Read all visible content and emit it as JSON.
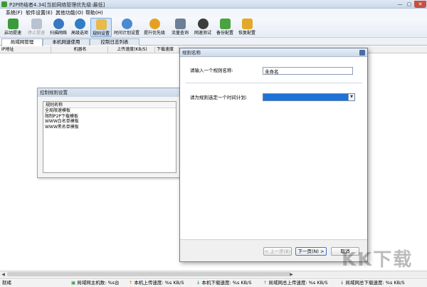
{
  "window": {
    "title": "P2P终结者4.34[当前网络管理优先级:最低]"
  },
  "menu": [
    "系统(F)",
    "软件设置(E)",
    "其他功能(O)",
    "帮助(H)"
  ],
  "toolbar": [
    {
      "label": "启动提速",
      "icon": "play-icon",
      "color": "#3b9b3b"
    },
    {
      "label": "停止提速",
      "icon": "stop-icon",
      "color": "#b9c3cf",
      "disabled": true
    },
    {
      "label": "扫描网络",
      "icon": "search-icon",
      "color": "#3a78c2"
    },
    {
      "label": "高级选项",
      "icon": "globe-icon",
      "color": "#2f7fc7"
    },
    {
      "label": "规则设置",
      "icon": "document-icon",
      "color": "#e9b949",
      "active": true
    },
    {
      "label": "时间计划设置",
      "icon": "clock-icon",
      "color": "#4a8ad1"
    },
    {
      "label": "提升优先级",
      "icon": "medal-icon",
      "color": "#e6a021"
    },
    {
      "label": "流量查询",
      "icon": "database-icon",
      "color": "#6c7f97"
    },
    {
      "label": "网速测试",
      "icon": "gauge-icon",
      "color": "#3d3d3d"
    },
    {
      "label": "备份配置",
      "icon": "download-icon",
      "color": "#49a341"
    },
    {
      "label": "恢复配置",
      "icon": "gift-icon",
      "color": "#e3a82b"
    }
  ],
  "tabs": [
    "局域网管理",
    "本机网速使用",
    "控制日志列表"
  ],
  "columns": [
    "IP地址",
    "机器名",
    "上传速度(KB/S)",
    "下载速度"
  ],
  "rules_panel": {
    "title": "控制规则设置",
    "list_header": "规则名称",
    "items": [
      "全局限速模板",
      "限制P2P下载模板",
      "WWW白名单模板",
      "WWW黑名单模板"
    ]
  },
  "dialog": {
    "title": "规则名称",
    "name_label": "请输入一个规则名称:",
    "name_value": "未命名",
    "plan_label": "请为规则选定一个时间计划:",
    "prev_label": "< 上一步(B)",
    "next_label": "下一页(N) >",
    "cancel_label": "取消"
  },
  "status": {
    "ready": "就绪",
    "host_count": "局域网主机数: %s台",
    "local_up": "本机上传速度: %s KB/S",
    "local_down": "本机下载速度: %s KB/S",
    "lan_up": "局域网总上传速度: %s KB/S",
    "lan_down": "局域网总下载速度: %s KB/S"
  },
  "watermark": "KK下载"
}
